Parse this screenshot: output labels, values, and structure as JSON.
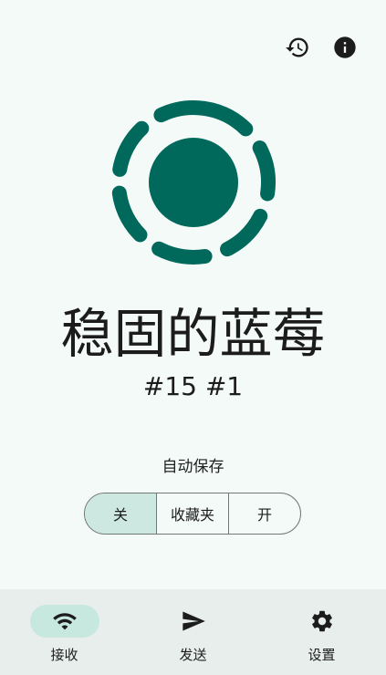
{
  "header": {
    "history_icon": "history-icon",
    "info_icon": "info-icon"
  },
  "device": {
    "name": "稳固的蓝莓",
    "id": "#15 #1",
    "accent": "#00695c"
  },
  "autosave": {
    "label": "自动保存",
    "options": [
      "关",
      "收藏夹",
      "开"
    ],
    "selected": "关"
  },
  "nav": {
    "items": [
      {
        "label": "接收",
        "icon": "wifi-icon",
        "active": true
      },
      {
        "label": "发送",
        "icon": "send-icon",
        "active": false
      },
      {
        "label": "设置",
        "icon": "gear-icon",
        "active": false
      }
    ]
  },
  "colors": {
    "background": "#f4faf8",
    "selected_segment": "#cde8e1",
    "nav_background": "#e8eeec",
    "nav_active_pill": "#c7e8de"
  }
}
